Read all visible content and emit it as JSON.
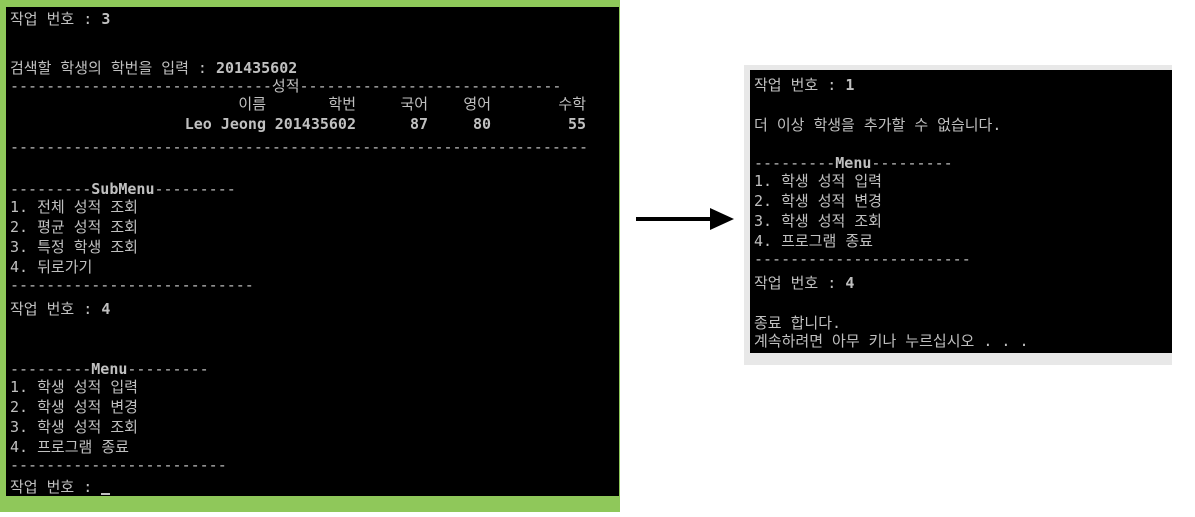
{
  "left_console": {
    "task_prompt_1": "작업 번호 :",
    "task_value_1": "3",
    "search_prompt": "검색할 학생의 학번을 입력 :",
    "search_value": "201435602",
    "grades_header": "성적",
    "table_headers": [
      "이름",
      "학번",
      "국어",
      "영어",
      "수학"
    ],
    "table_row": [
      "Leo Jeong",
      "201435602",
      "87",
      "80",
      "55"
    ],
    "submenu_title": "SubMenu",
    "submenu_items": [
      "1. 전체 성적 조회",
      "2. 평균 성적 조회",
      "3. 특정 학생 조회",
      "4. 뒤로가기"
    ],
    "task_prompt_2": "작업 번호 :",
    "task_value_2": "4",
    "menu_title": "Menu",
    "menu_items": [
      "1. 학생 성적 입력",
      "2. 학생 성적 변경",
      "3. 학생 성적 조회",
      "4. 프로그램 종료"
    ],
    "task_prompt_3": "작업 번호 :"
  },
  "right_console": {
    "task_prompt_1": "작업 번호 :",
    "task_value_1": "1",
    "message": "더 이상 학생을 추가할 수 없습니다.",
    "menu_title": "Menu",
    "menu_items": [
      "1. 학생 성적 입력",
      "2. 학생 성적 변경",
      "3. 학생 성적 조회",
      "4. 프로그램 종료"
    ],
    "task_prompt_2": "작업 번호 :",
    "task_value_2": "4",
    "exit_message": "종료 합니다.",
    "continue_message": "계속하려면 아무 키나 누르십시오 . . ."
  },
  "colors": {
    "console_bg": "#000000",
    "console_text": "#c0c0c0",
    "frame_green": "#8fc85a",
    "arrow": "#000000"
  },
  "arrow_icon": "right-arrow-icon"
}
